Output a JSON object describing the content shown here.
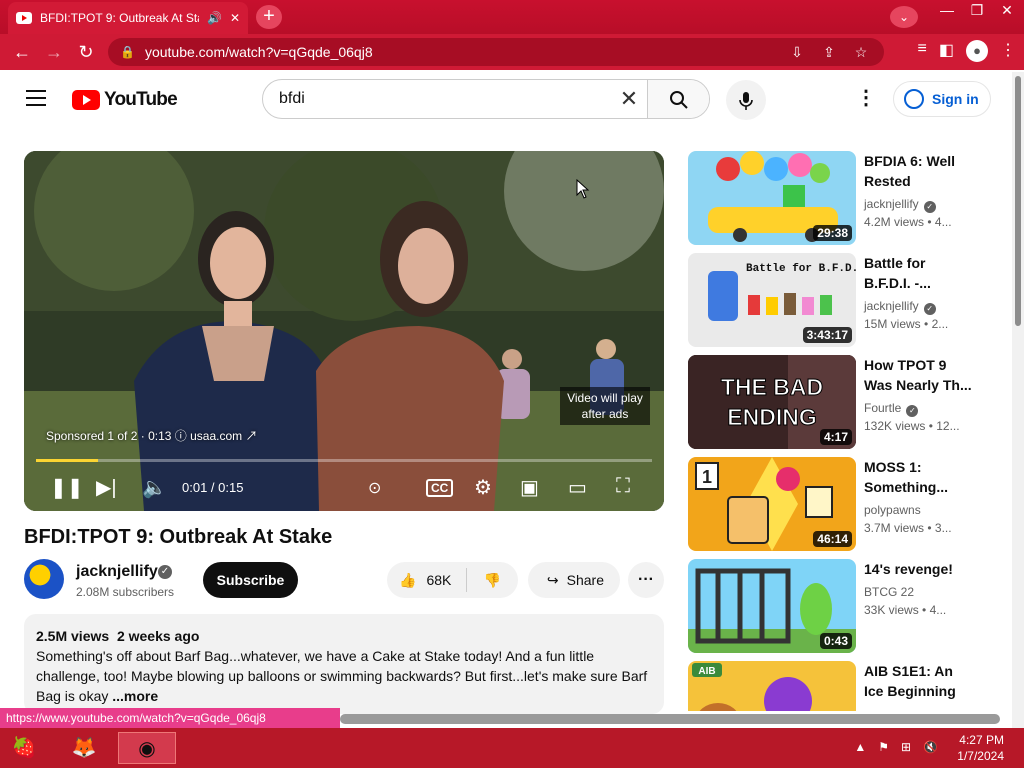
{
  "browser": {
    "tab_title": "BFDI:TPOT 9: Outbreak At Sta",
    "url": "youtube.com/watch?v=qGqde_06qj8",
    "status_url": "https://www.youtube.com/watch?v=qGqde_06qj8"
  },
  "yt_header": {
    "logo_text": "YouTube",
    "search_value": "bfdi",
    "signin_label": "Sign in"
  },
  "player": {
    "sponsor_text": "Sponsored 1 of 2 · 0:13",
    "sponsor_domain": "usaa.com",
    "ad_notice_line1": "Video will play",
    "ad_notice_line2": "after ads",
    "time": "0:01 / 0:15",
    "progress_fraction": 0.1
  },
  "video": {
    "title": "BFDI:TPOT 9: Outbreak At Stake",
    "channel": "jacknjellify",
    "subscribers": "2.08M subscribers",
    "subscribe_label": "Subscribe",
    "likes": "68K",
    "share_label": "Share",
    "views": "2.5M views",
    "age": "2 weeks ago",
    "description": "Something's off about Barf Bag...whatever, we have a Cake at Stake today! And a fun little challenge, too! Maybe blowing up balloons or swimming backwards? But first...let's make sure Barf Bag is okay",
    "more_label": "...more"
  },
  "related": [
    {
      "title_1": "BFDIA 6: Well",
      "title_2": "Rested",
      "channel": "jacknjellify",
      "verified": true,
      "views": "4.2M views",
      "age": "• 4...",
      "duration": "29:38"
    },
    {
      "title_1": "Battle for",
      "title_2": "B.F.D.I. -...",
      "channel": "jacknjellify",
      "verified": true,
      "views": "15M views",
      "age": "• 2...",
      "duration": "3:43:17"
    },
    {
      "title_1": "How TPOT 9",
      "title_2": "Was Nearly Th...",
      "channel": "Fourtle",
      "verified": true,
      "views": "132K views",
      "age": "• 12...",
      "duration": "4:17"
    },
    {
      "title_1": "MOSS 1:",
      "title_2": "Something...",
      "channel": "polypawns",
      "verified": false,
      "views": "3.7M views",
      "age": "• 3...",
      "duration": "46:14"
    },
    {
      "title_1": "14's revenge!",
      "title_2": "",
      "channel": "BTCG 22",
      "verified": false,
      "views": "33K views",
      "age": "• 4...",
      "duration": "0:43"
    },
    {
      "title_1": "AIB S1E1: An",
      "title_2": "Ice Beginning",
      "channel": "",
      "verified": false,
      "views": "",
      "age": "",
      "duration": ""
    }
  ],
  "thumb_text": {
    "battle_caption": "Battle for B.F.D.I.",
    "bad_ending": "THE BAD ENDING",
    "moss_number": "1",
    "aib_label": "AIB"
  },
  "taskbar": {
    "time": "4:27 PM",
    "date": "1/7/2024"
  },
  "colors": {
    "chrome_red": "#c8102e",
    "yt_red": "#ff0000",
    "ad_progress": "#fbd532",
    "link_blue": "#065fd4"
  }
}
